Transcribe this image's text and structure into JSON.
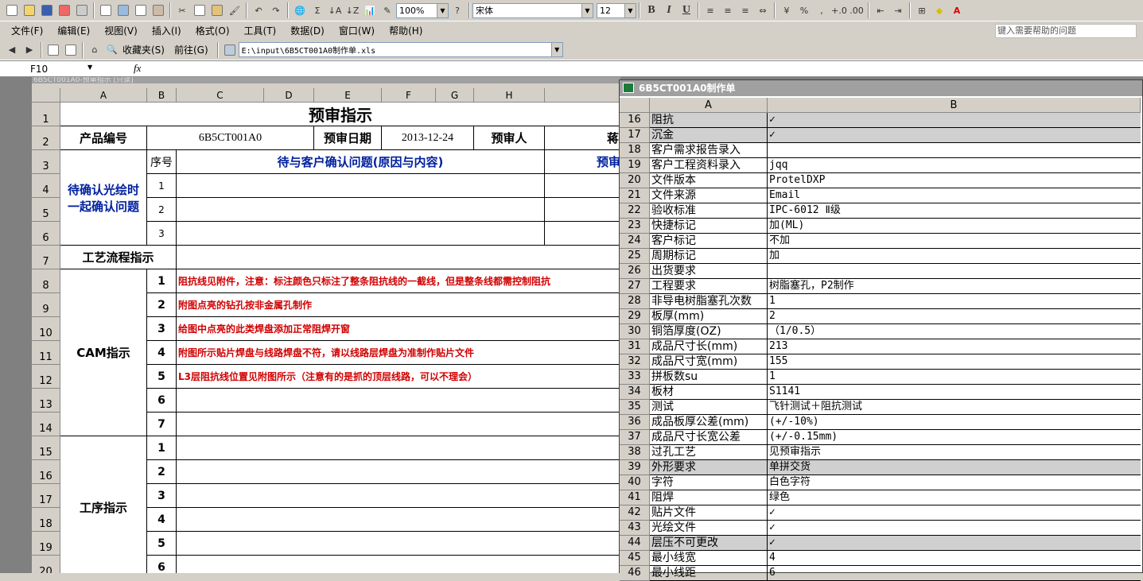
{
  "toolbar1": {
    "zoom": "100%",
    "font": "宋体",
    "font_size": "12",
    "bold": "B",
    "italic": "I",
    "underline": "U",
    "percent": "%",
    "comma": ","
  },
  "menu": [
    "文件(F)",
    "编辑(E)",
    "视图(V)",
    "插入(I)",
    "格式(O)",
    "工具(T)",
    "数据(D)",
    "窗口(W)",
    "帮助(H)"
  ],
  "help_placeholder": "键入需要帮助的问题",
  "toolbar3": {
    "favorites": "收藏夹(S)",
    "goto": "前往(G)",
    "path": "E:\\input\\6B5CT001A0制作单.xls"
  },
  "formula": {
    "namebox": "F10",
    "fx": "fx"
  },
  "sheet1": {
    "window_title": "6B5CT001A0-预审指示 [只读]",
    "columns": [
      "A",
      "B",
      "C",
      "D",
      "E",
      "F",
      "G",
      "H"
    ],
    "rows": [
      "1",
      "2",
      "3",
      "4",
      "5",
      "6",
      "7",
      "8",
      "9",
      "10",
      "11",
      "12",
      "13",
      "14",
      "15",
      "16",
      "17",
      "18",
      "19",
      "20"
    ],
    "title": "预审指示",
    "product_no_label": "产品编号",
    "product_no": "6B5CT001A0",
    "review_date_label": "预审日期",
    "review_date": "2013-12-24",
    "reviewer_label": "预审人",
    "reviewer": "蒋",
    "confirm_label": "待确认光绘时一起确认问题",
    "seq_label": "序号",
    "question_header": "待与客户确认问题(原因与内容)",
    "review_header": "预审",
    "confirm_nums": [
      "1",
      "2",
      "3"
    ],
    "flow_label": "工艺流程指示",
    "cam_label": "CAM指示",
    "cam_nums": [
      "1",
      "2",
      "3",
      "4",
      "5",
      "6",
      "7"
    ],
    "cam_items": [
      "阻抗线见附件，注意：标注颜色只标注了整条阻抗线的一截线，但是整条线都需控制阻抗",
      "附图点亮的钻孔按非金属孔制作",
      "给图中点亮的此类焊盘添加正常阻焊开窗",
      "附图所示贴片焊盘与线路焊盘不符，请以线路层焊盘为准制作贴片文件",
      "L3层阻抗线位置见附图所示（注意有的是抓的顶层线路，可以不理会）",
      "",
      ""
    ],
    "process_label": "工序指示",
    "process_nums": [
      "1",
      "2",
      "3",
      "4",
      "5",
      "6"
    ]
  },
  "sheet2": {
    "window_title": "6B5CT001A0制作单",
    "col_a": "A",
    "col_b": "B",
    "rows": [
      {
        "n": "16",
        "a": "阻抗",
        "b": "✓",
        "gray": true
      },
      {
        "n": "17",
        "a": "沉金",
        "b": "✓",
        "gray": true
      },
      {
        "n": "18",
        "a": "客户需求报告录入",
        "b": ""
      },
      {
        "n": "19",
        "a": "客户工程资料录入",
        "b": "jqq"
      },
      {
        "n": "20",
        "a": "文件版本",
        "b": "ProtelDXP"
      },
      {
        "n": "21",
        "a": "文件来源",
        "b": "Email"
      },
      {
        "n": "22",
        "a": "验收标准",
        "b": "IPC-6012 Ⅱ级"
      },
      {
        "n": "23",
        "a": "快捷标记",
        "b": "加(ML)"
      },
      {
        "n": "24",
        "a": "客户标记",
        "b": "不加"
      },
      {
        "n": "25",
        "a": "周期标记",
        "b": "加"
      },
      {
        "n": "26",
        "a": "出货要求",
        "b": ""
      },
      {
        "n": "27",
        "a": "工程要求",
        "b": "树脂塞孔，P2制作"
      },
      {
        "n": "28",
        "a": "非导电树脂塞孔次数",
        "b": "1"
      },
      {
        "n": "29",
        "a": "板厚(mm)",
        "b": "2"
      },
      {
        "n": "30",
        "a": "铜箔厚度(OZ)",
        "b": "（1/0.5）"
      },
      {
        "n": "31",
        "a": "成品尺寸长(mm)",
        "b": "213"
      },
      {
        "n": "32",
        "a": "成品尺寸宽(mm)",
        "b": "155"
      },
      {
        "n": "33",
        "a": "拼板数su",
        "b": "1"
      },
      {
        "n": "34",
        "a": "板材",
        "b": "S1141"
      },
      {
        "n": "35",
        "a": "测试",
        "b": "飞针测试＋阻抗测试"
      },
      {
        "n": "36",
        "a": "成品板厚公差(mm)",
        "b": "(+/-10%)"
      },
      {
        "n": "37",
        "a": "成品尺寸长宽公差",
        "b": "(+/-0.15mm)"
      },
      {
        "n": "38",
        "a": "过孔工艺",
        "b": "见预审指示"
      },
      {
        "n": "39",
        "a": "外形要求",
        "b": "单拼交货",
        "gray": true
      },
      {
        "n": "40",
        "a": "字符",
        "b": "白色字符"
      },
      {
        "n": "41",
        "a": "阻焊",
        "b": "绿色"
      },
      {
        "n": "42",
        "a": "贴片文件",
        "b": "✓"
      },
      {
        "n": "43",
        "a": "光绘文件",
        "b": "✓"
      },
      {
        "n": "44",
        "a": "层压不可更改",
        "b": "✓",
        "gray": true
      },
      {
        "n": "45",
        "a": "最小线宽",
        "b": "4"
      },
      {
        "n": "46",
        "a": "最小线距",
        "b": "6"
      }
    ]
  }
}
